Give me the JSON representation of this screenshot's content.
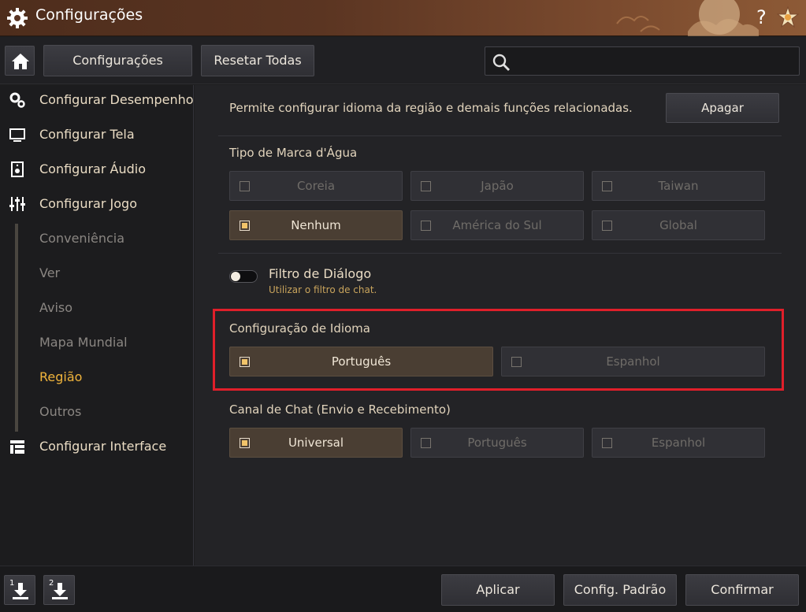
{
  "window": {
    "title": "Configurações",
    "help_label": "?"
  },
  "toolbar": {
    "configuracoes_label": "Configurações",
    "reset_label": "Resetar Todas",
    "search_placeholder": ""
  },
  "sidebar": {
    "items": [
      {
        "label": "Configurar Desempenho",
        "icon": "performance-gears-icon"
      },
      {
        "label": "Configurar Tela",
        "icon": "monitor-icon"
      },
      {
        "label": "Configurar Áudio",
        "icon": "speaker-icon"
      },
      {
        "label": "Configurar Jogo",
        "icon": "sliders-icon"
      },
      {
        "label": "Configurar Interface",
        "icon": "layout-icon"
      }
    ],
    "sub_items": [
      "Conveniência",
      "Ver",
      "Aviso",
      "Mapa Mundial",
      "Região",
      "Outros"
    ],
    "active_sub": "Região"
  },
  "main": {
    "description": "Permite configurar idioma da região e demais funções relacionadas.",
    "apagar_label": "Apagar",
    "watermark": {
      "title": "Tipo de Marca d'Água",
      "options": [
        "Coreia",
        "Japão",
        "Taiwan",
        "Nenhum",
        "América do Sul",
        "Global"
      ],
      "selected": "Nenhum"
    },
    "dialog_filter": {
      "label": "Filtro de Diálogo",
      "sublabel": "Utilizar o filtro de chat.",
      "enabled": false
    },
    "language": {
      "title": "Configuração de Idioma",
      "options": [
        "Português",
        "Espanhol"
      ],
      "selected": "Português"
    },
    "chat_channel": {
      "title": "Canal de Chat (Envio e Recebimento)",
      "options": [
        "Universal",
        "Português",
        "Espanhol"
      ],
      "selected": "Universal"
    }
  },
  "footer": {
    "slot1_label": "1",
    "slot2_label": "2",
    "apply_label": "Aplicar",
    "default_label": "Config. Padrão",
    "confirm_label": "Confirmar"
  },
  "colors": {
    "accent_active": "#f0b43c",
    "selected_option_bg": "#4a3e33",
    "highlight_border": "#e01f2a"
  }
}
